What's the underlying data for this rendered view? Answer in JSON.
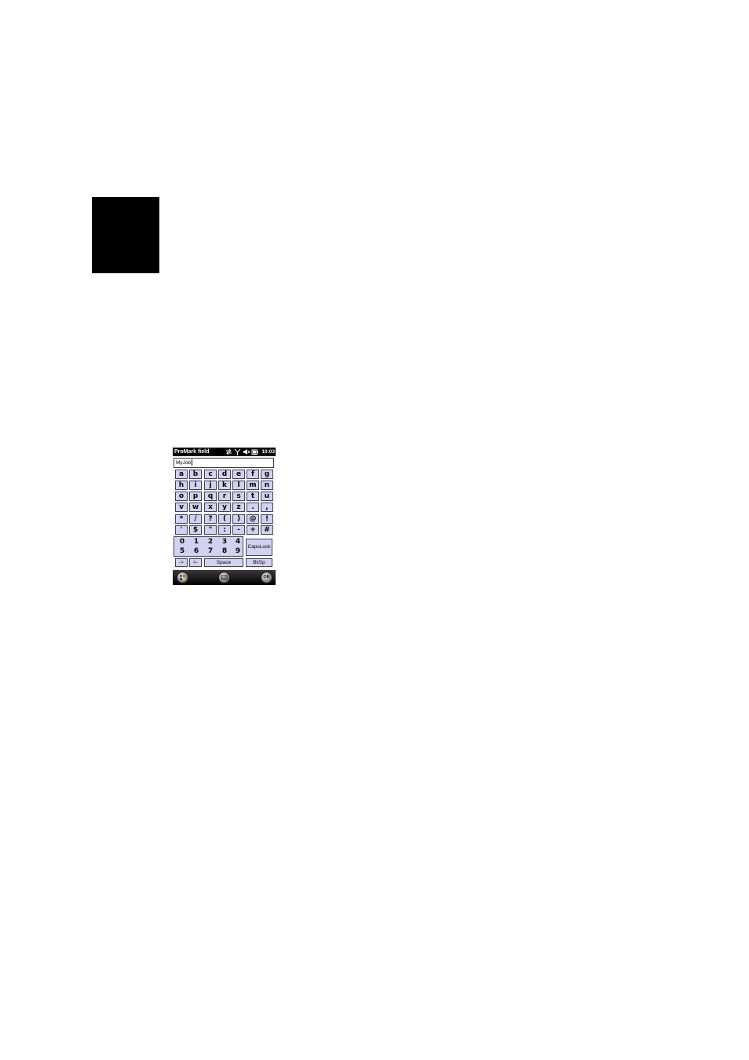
{
  "status_bar": {
    "title": "ProMark field",
    "time": "10:03",
    "icons": [
      "sync-icon",
      "signal-icon",
      "speaker-icon",
      "battery-icon"
    ]
  },
  "text_field": {
    "value": "MyJob"
  },
  "keyboard": {
    "letter_rows": [
      [
        "a",
        "b",
        "c",
        "d",
        "e",
        "f",
        "g"
      ],
      [
        "h",
        "i",
        "j",
        "k",
        "l",
        "m",
        "n"
      ],
      [
        "o",
        "p",
        "q",
        "r",
        "s",
        "t",
        "u"
      ],
      [
        "v",
        "w",
        "x",
        "y",
        "z",
        ".",
        ","
      ],
      [
        "*",
        "/",
        "?",
        "(",
        ")",
        "@",
        "!"
      ],
      [
        "'",
        "$",
        "\"",
        ":",
        "-",
        "+",
        "#"
      ]
    ],
    "digits_row1": [
      "0",
      "1",
      "2",
      "3",
      "4"
    ],
    "digits_row2": [
      "5",
      "6",
      "7",
      "8",
      "9"
    ],
    "capslock_label": "CapsLock",
    "right_arrow_label": "->",
    "left_arrow_label": "<-",
    "space_label": "Space",
    "backspace_label": "BkSp"
  },
  "bottom_bar": {
    "start_icon": "windows-start-icon",
    "keyboard_icon": "keyboard-icon",
    "ok_label": "OK"
  },
  "colors": {
    "key_fill": "#d2d2f0",
    "bar": "#000000"
  }
}
